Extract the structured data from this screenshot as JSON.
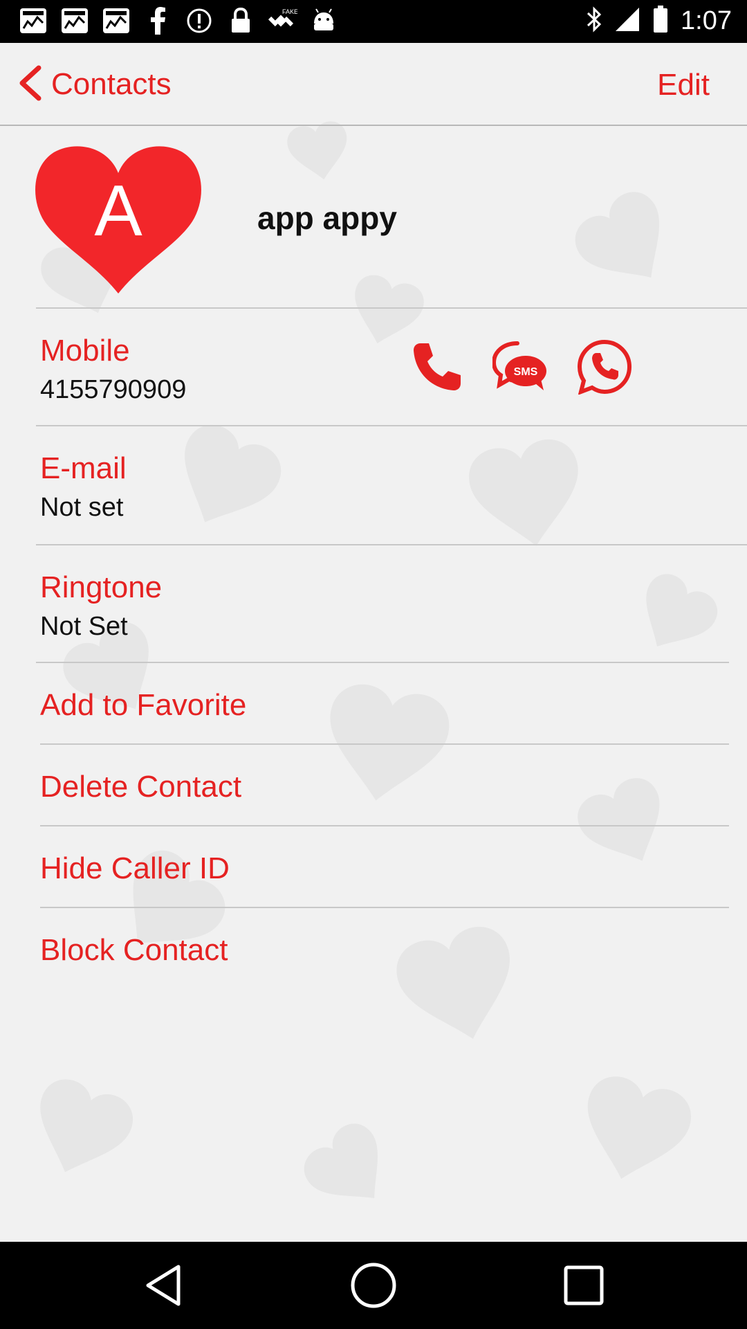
{
  "status_bar": {
    "time": "1:07",
    "notification_icons": [
      "iifl-markets-icon",
      "iifl-markets-icon",
      "iifl-markets-icon",
      "facebook-icon",
      "alert-icon",
      "lock-icon",
      "fake-gps-icon",
      "android-icon"
    ],
    "system_icons": [
      "bluetooth-icon",
      "signal-icon",
      "battery-icon"
    ]
  },
  "header": {
    "back_label": "Contacts",
    "edit_label": "Edit"
  },
  "contact": {
    "avatar_letter": "A",
    "name": "app appy"
  },
  "fields": {
    "mobile_label": "Mobile",
    "mobile_value": "4155790909",
    "email_label": "E-mail",
    "email_value": "Not set",
    "ringtone_label": "Ringtone",
    "ringtone_value": "Not Set"
  },
  "actions": {
    "sms_text": "SMS"
  },
  "menu": {
    "favorite": "Add to Favorite",
    "delete": "Delete Contact",
    "hide_caller": "Hide Caller ID",
    "block": "Block Contact"
  },
  "colors": {
    "accent": "#e52222",
    "background": "#f1f1f1"
  }
}
